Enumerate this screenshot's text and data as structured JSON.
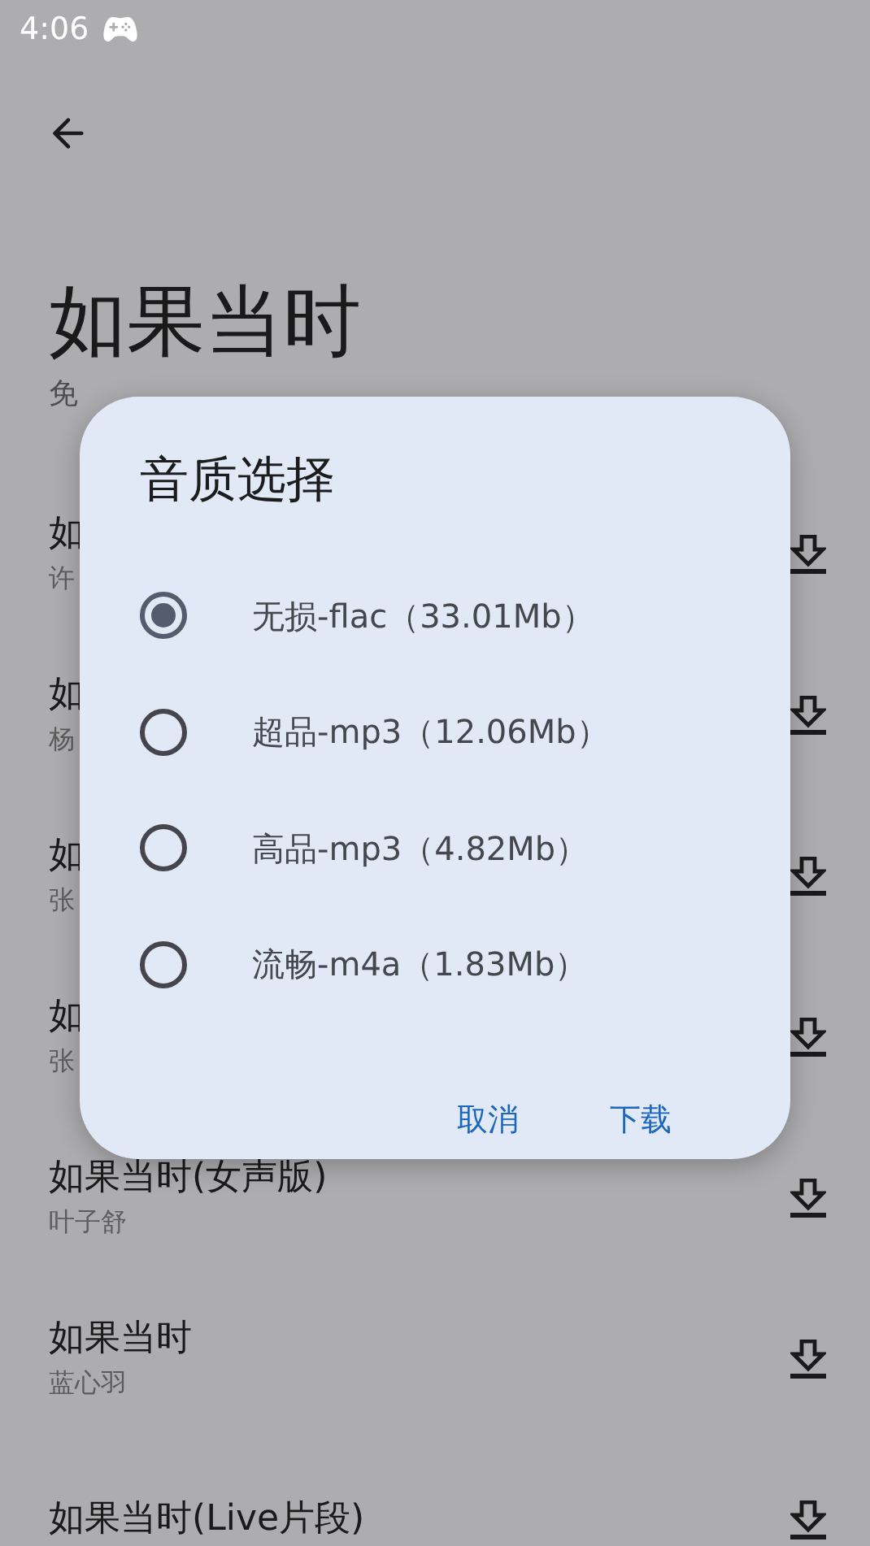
{
  "status_bar": {
    "time": "4:06"
  },
  "page": {
    "title": "如果当时",
    "subtitle": "免"
  },
  "songs": [
    {
      "title": "如",
      "artist": "许"
    },
    {
      "title": "如",
      "artist": "杨"
    },
    {
      "title": "如",
      "artist": "张"
    },
    {
      "title": "如",
      "artist": "张"
    },
    {
      "title": "如果当时(女声版)",
      "artist": "叶子舒"
    },
    {
      "title": "如果当时",
      "artist": "蓝心羽"
    },
    {
      "title": "如果当时(Live片段)"
    }
  ],
  "dialog": {
    "title": "音质选择",
    "options": [
      {
        "label": "无损-flac（33.01Mb）",
        "selected": true
      },
      {
        "label": "超品-mp3（12.06Mb）",
        "selected": false
      },
      {
        "label": "高品-mp3（4.82Mb）",
        "selected": false
      },
      {
        "label": "流畅-m4a（1.83Mb）",
        "selected": false
      }
    ],
    "buttons": [
      "取消",
      "下载"
    ]
  }
}
